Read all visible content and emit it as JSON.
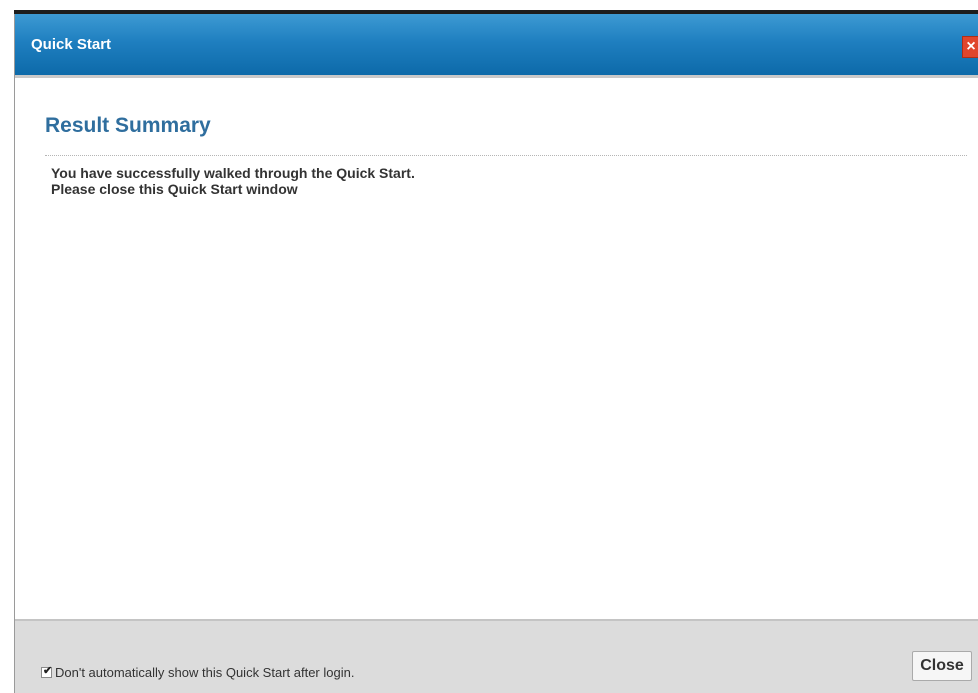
{
  "dialog": {
    "title": "Quick Start",
    "close_icon": "close-icon",
    "accent_color": "#1f7fc0",
    "close_color": "#e0452c"
  },
  "content": {
    "section_title": "Result Summary",
    "message_line1": "You have successfully walked through the Quick Start.",
    "message_line2": "Please close this Quick Start window"
  },
  "footer": {
    "checkbox_label": "Don't automatically show this Quick Start after login.",
    "checkbox_checked": true,
    "close_label": "Close"
  }
}
